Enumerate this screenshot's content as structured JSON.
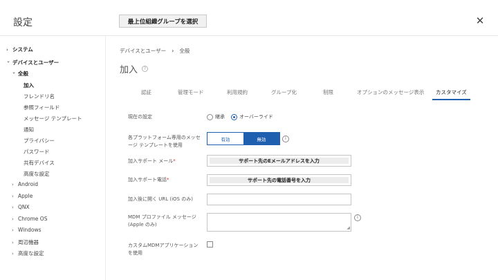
{
  "header": {
    "title": "設定",
    "org_button": "最上位組織グループを選択",
    "close": "✕"
  },
  "sidebar": {
    "items": [
      {
        "label": "システム",
        "caret": "›"
      },
      {
        "label": "デバイスとユーザー",
        "caret": "›"
      },
      {
        "label": "全般",
        "caret": "›"
      },
      {
        "label": "加入"
      },
      {
        "label": "フレンドリ名"
      },
      {
        "label": "参照フィールド"
      },
      {
        "label": "メッセージ テンプレート"
      },
      {
        "label": "通知"
      },
      {
        "label": "プライバシー"
      },
      {
        "label": "パスワード"
      },
      {
        "label": "共有デバイス"
      },
      {
        "label": "高度な設定"
      },
      {
        "label": "Android",
        "caret": "›"
      },
      {
        "label": "Apple",
        "caret": "›"
      },
      {
        "label": "QNX",
        "caret": "›"
      },
      {
        "label": "Chrome OS",
        "caret": "›"
      },
      {
        "label": "Windows",
        "caret": "›"
      },
      {
        "label": "周辺機器",
        "caret": "›"
      },
      {
        "label": "高度な設定",
        "caret": "›"
      }
    ]
  },
  "breadcrumb": {
    "parent": "デバイスとユーザー",
    "separator": "›",
    "current": "全般"
  },
  "page": {
    "title": "加入",
    "help_icon": "?"
  },
  "tabs": [
    {
      "label": "認証"
    },
    {
      "label": "管理モード"
    },
    {
      "label": "利用規約"
    },
    {
      "label": "グループ化"
    },
    {
      "label": "制限"
    },
    {
      "label": "オプションのメッセージ表示"
    },
    {
      "label": "カスタマイズ",
      "active": true
    }
  ],
  "form": {
    "current_setting": {
      "label": "現在の設定",
      "options": [
        "継承",
        "オーバーライド"
      ],
      "selected": "オーバーライド"
    },
    "platform_template": {
      "label_line1": "各プラットフォーム専用のメッセ",
      "label_line2": "ージ テンプレートを使用",
      "enabled_label": "有効",
      "disabled_label": "無効",
      "selected": "無効",
      "info_icon": "i"
    },
    "support_email": {
      "label": "加入サポート メール",
      "required_mark": "*",
      "value": "サポート先のEメールアドレスを入力"
    },
    "support_phone": {
      "label": "加入サポート電話",
      "required_mark": "*",
      "value": "サポート先の電話番号を入力"
    },
    "post_url": {
      "label": "加入後に開く URL (iOS のみ)",
      "value": ""
    },
    "mdm_message": {
      "label_line1": "MDM プロファイル メッセージ",
      "label_line2": "(Apple のみ)",
      "value": "",
      "info_icon": "i"
    },
    "custom_mdm_app": {
      "label_line1": "カスタムMDMアプリケーション",
      "label_line2": "を使用",
      "checked": false
    }
  },
  "colors": {
    "accent": "#1f5fb0",
    "required": "#d12c2c"
  }
}
